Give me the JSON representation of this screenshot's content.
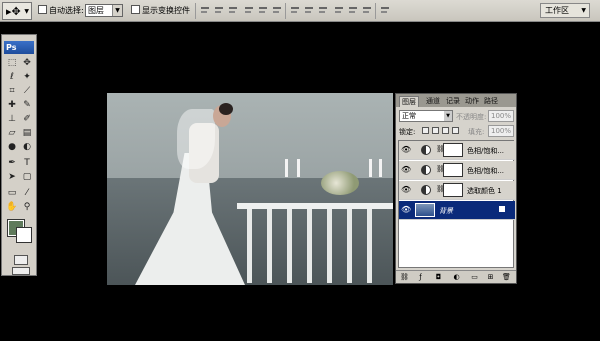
{
  "options_bar": {
    "auto_select_label": "自动选择:",
    "auto_select_value": "图层",
    "show_transform_label": "显示变换控件",
    "workspace_label": "工作区"
  },
  "toolbox": {
    "logo": "Ps",
    "foreground_color": "#5f7a5b",
    "background_color": "#ffffff"
  },
  "layers_panel": {
    "tabs": [
      "图层",
      "通道",
      "记录",
      "动作",
      "路径"
    ],
    "blend_mode": "正常",
    "opacity_label": "不透明度:",
    "opacity_value": "100%",
    "lock_label": "锁定:",
    "fill_label": "填充:",
    "fill_value": "100%",
    "layers": [
      {
        "name": "色相/饱和...",
        "type": "adjustment",
        "visible": true,
        "selected": false
      },
      {
        "name": "色相/饱和...",
        "type": "adjustment",
        "visible": true,
        "selected": false
      },
      {
        "name": "选取颜色 1",
        "type": "adjustment",
        "visible": true,
        "selected": false
      },
      {
        "name": "背景",
        "type": "image",
        "visible": true,
        "selected": true
      }
    ]
  },
  "icons": {
    "eye": "eye-icon",
    "chain": "chain-link-icon",
    "lock": "lock-icon"
  }
}
